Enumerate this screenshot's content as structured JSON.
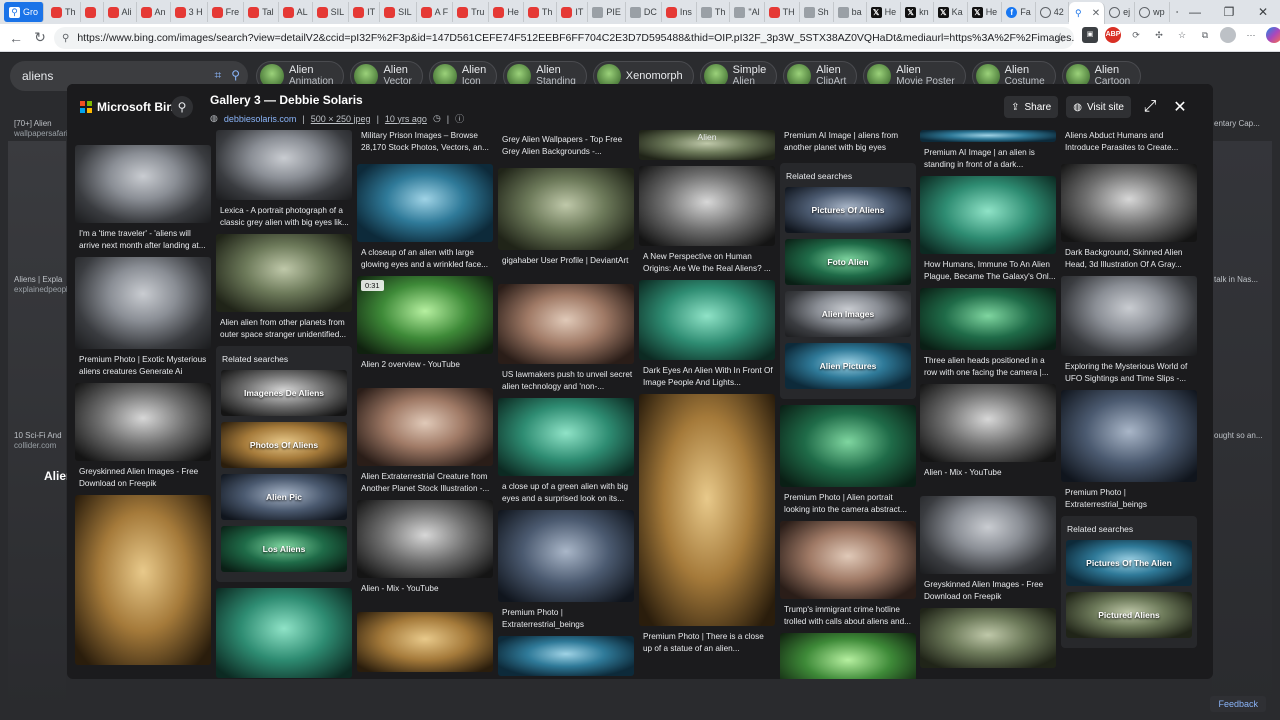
{
  "browser": {
    "tabs": [
      {
        "label": "Gro",
        "icon": "bing"
      },
      {
        "label": "Th",
        "icon": "youtube"
      },
      {
        "label": "",
        "icon": "youtube"
      },
      {
        "label": "Ali",
        "icon": "youtube"
      },
      {
        "label": "An",
        "icon": "youtube"
      },
      {
        "label": "3 H",
        "icon": "youtube"
      },
      {
        "label": "Fre",
        "icon": "youtube"
      },
      {
        "label": "Tal",
        "icon": "youtube"
      },
      {
        "label": "AL",
        "icon": "youtube"
      },
      {
        "label": "SIL",
        "icon": "youtube"
      },
      {
        "label": "IT",
        "icon": "youtube"
      },
      {
        "label": "SIL",
        "icon": "youtube"
      },
      {
        "label": "A F",
        "icon": "youtube"
      },
      {
        "label": "Tru",
        "icon": "youtube"
      },
      {
        "label": "He",
        "icon": "youtube"
      },
      {
        "label": "Th",
        "icon": "youtube"
      },
      {
        "label": "IT",
        "icon": "youtube"
      },
      {
        "label": "PIE",
        "icon": "doc"
      },
      {
        "label": "DC",
        "icon": "doc"
      },
      {
        "label": "Ins",
        "icon": "youtube"
      },
      {
        "label": "Th",
        "icon": "doc"
      },
      {
        "label": "\"Al",
        "icon": "doc"
      },
      {
        "label": "TH",
        "icon": "youtube"
      },
      {
        "label": "Sh",
        "icon": "doc"
      },
      {
        "label": "ba",
        "icon": "doc"
      },
      {
        "label": "He",
        "icon": "x"
      },
      {
        "label": "kn",
        "icon": "x"
      },
      {
        "label": "Ka",
        "icon": "x"
      },
      {
        "label": "He",
        "icon": "x"
      },
      {
        "label": "Fa",
        "icon": "facebook"
      },
      {
        "label": "42",
        "icon": "globe"
      },
      {
        "label": "",
        "icon": "bing",
        "active": true
      },
      {
        "label": "ej",
        "icon": "globe"
      },
      {
        "label": "wp",
        "icon": "globe"
      }
    ],
    "url": "https://www.bing.com/images/search?view=detailV2&ccid=pI32F%2F3p&id=147D561CEFE74F512EEBF6FF704C2E3D7D595488&thid=OIP.pI32F_3p3W_5STX38AZ0VQHaDt&mediaurl=https%3A%2F%2Fimages.squarespace-cdn.com%2F...",
    "ext_badge": "ABP"
  },
  "search": {
    "query": "aliens",
    "pills": [
      {
        "line1": "Alien",
        "line2": "Animation"
      },
      {
        "line1": "Alien",
        "line2": "Vector"
      },
      {
        "line1": "Alien",
        "line2": "Icon"
      },
      {
        "line1": "Alien",
        "line2": "Standing"
      },
      {
        "line1": "Xenomorph",
        "line2": ""
      },
      {
        "line1": "Simple",
        "line2": "Alien"
      },
      {
        "line1": "Alien",
        "line2": "ClipArt"
      },
      {
        "line1": "Alien",
        "line2": "Movie Poster"
      },
      {
        "line1": "Alien",
        "line2": "Costume"
      },
      {
        "line1": "Alien",
        "line2": "Cartoon"
      }
    ],
    "bg_texts": [
      "[70+] Alien",
      "wallpapersafari",
      "Aliens | Expla",
      "explainedpeople",
      "10 Sci-Fi And",
      "collider.com",
      "Alien",
      "entary Cap...",
      "talk in Nas...",
      "ought so an..."
    ],
    "feedback": "Feedback"
  },
  "gallery": {
    "brand": "Microsoft Bing",
    "title": "Gallery 3 — Debbie Solaris",
    "source": "debbiesolaris.com",
    "dims": "500 × 250 jpeg",
    "age": "10 yrs ago",
    "share": "Share",
    "visit": "Visit site",
    "related_title": "Related searches",
    "col1": [
      {
        "caption": "I'm a 'time traveler' - 'aliens will arrive next month after landing at..."
      },
      {
        "caption": "Premium Photo | Exotic Mysterious aliens creatures Generate Ai"
      },
      {
        "caption": "Greyskinned Alien Images - Free Download on Freepik"
      },
      {
        "caption": ""
      }
    ],
    "col2": [
      {
        "caption": "Lexica - A portrait photograph of a classic grey alien with big eyes lik..."
      },
      {
        "caption": "Alien alien from other planets from outer space stranger unidentified..."
      },
      {
        "caption": ""
      }
    ],
    "col2_related": [
      "Imagenes De Aliens",
      "Photos Of Aliens",
      "Alien Pic",
      "Los Aliens"
    ],
    "col3": [
      {
        "caption": "Military Prison Images – Browse 28,170 Stock Photos, Vectors, an..."
      },
      {
        "caption": "A closeup of an alien with large glowing eyes and a wrinkled face..."
      },
      {
        "caption": "Alien 2 overview - YouTube",
        "duration": "0:31"
      },
      {
        "caption": "Alien Extraterrestrial Creature from Another Planet Stock Illustration -..."
      },
      {
        "caption": "Alien - Mix - YouTube"
      },
      {
        "caption": ""
      }
    ],
    "col4": [
      {
        "caption": "Grey Alien Wallpapers - Top Free Grey Alien Backgrounds -..."
      },
      {
        "caption": "gigahaber User Profile | DeviantArt"
      },
      {
        "caption": "US lawmakers push to unveil secret alien technology and 'non-..."
      },
      {
        "caption": "a close up of a green alien with big eyes and a surprised look on its..."
      },
      {
        "caption": "Premium Photo | Extraterrestrial_beings"
      },
      {
        "caption": ""
      }
    ],
    "col5": [
      {
        "caption": "Alien"
      },
      {
        "caption": "A New Perspective on Human Origins: Are We the Real Aliens? ..."
      },
      {
        "caption": "Dark Eyes An Alien With In Front Of Image People And Lights..."
      },
      {
        "caption": "Premium Photo | There is a close up of a statue of an alien..."
      }
    ],
    "col6_top": {
      "caption": "Premium AI Image | aliens from another planet with big eyes"
    },
    "col6_related": [
      "Pictures Of Aliens",
      "Foto Alien",
      "Alien Images",
      "Alien Pictures"
    ],
    "col6": [
      {
        "caption": "Premium Photo | Alien portrait looking into the camera abstract..."
      },
      {
        "caption": "Trump's immigrant crime hotline trolled with calls about aliens and..."
      },
      {
        "caption": ""
      }
    ],
    "col7": [
      {
        "caption": "Premium AI Image | an alien is standing in front of a dark..."
      },
      {
        "caption": "How Humans, Immune To An Alien Plague, Became The Galaxy's Onl..."
      },
      {
        "caption": "Three alien heads positioned in a row with one facing the camera |..."
      },
      {
        "caption": "Alien - Mix - YouTube"
      },
      {
        "caption": "Greyskinned Alien Images - Free Download on Freepik"
      },
      {
        "caption": ""
      }
    ],
    "col8": [
      {
        "caption": "Aliens Abduct Humans and Introduce Parasites to Create..."
      },
      {
        "caption": "Dark Background, Skinned Alien Head, 3d Illustration Of A Gray..."
      },
      {
        "caption": "Exploring the Mysterious World of UFO Sightings and Time Slips -..."
      },
      {
        "caption": "Premium Photo | Extraterrestrial_beings"
      }
    ],
    "col8_related": [
      "Pictures Of The Alien",
      "Pictured Aliens"
    ]
  }
}
